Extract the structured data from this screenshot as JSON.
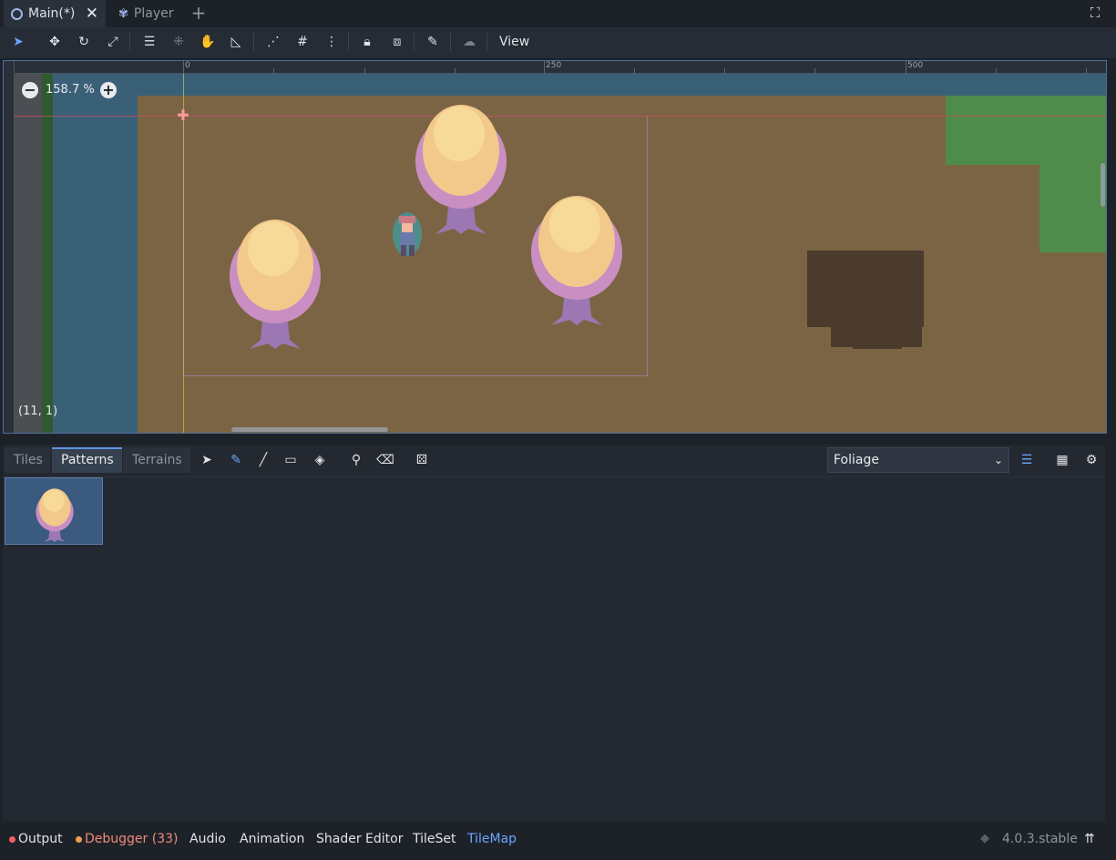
{
  "tabs": {
    "main": "Main(*)",
    "player": "Player",
    "add": "+"
  },
  "toolbar": {
    "view_label": "View"
  },
  "viewport": {
    "ruler_labels": [
      "0",
      "250",
      "500"
    ],
    "zoom_label": "158.7 %",
    "zoom_out": "−",
    "zoom_in": "+",
    "cursor_coords": "(11, 1)"
  },
  "tilemap_panel": {
    "tabs": [
      "Tiles",
      "Patterns",
      "Terrains"
    ],
    "selected_tab": "Patterns",
    "layer_value": "Foliage"
  },
  "bottom_bar": {
    "output": "Output",
    "debugger": "Debugger (33)",
    "audio": "Audio",
    "animation": "Animation",
    "shader_editor": "Shader Editor",
    "tileset": "TileSet",
    "tilemap": "TileMap",
    "version": "4.0.3.stable"
  },
  "colors": {
    "accent": "#6aa6ff",
    "debugger_text": "#f08a7a",
    "output_dot": "#f06060",
    "debugger_dot": "#f0a050",
    "tilemap_text": "#6aa6ff"
  }
}
